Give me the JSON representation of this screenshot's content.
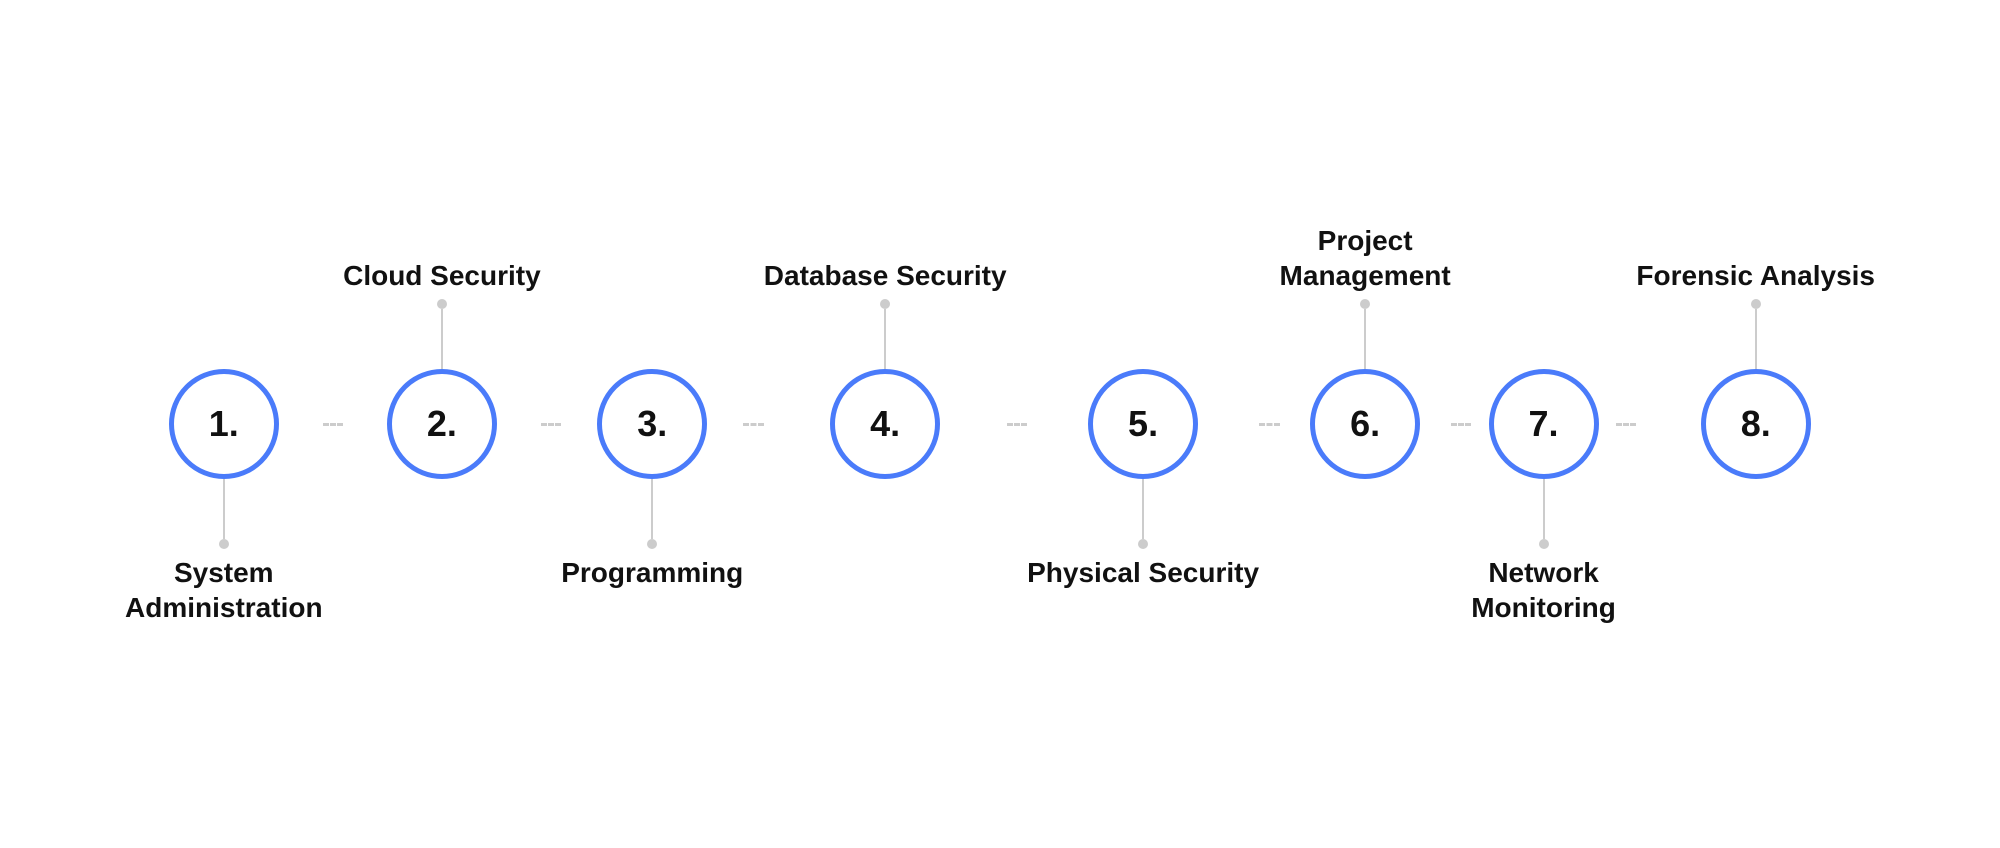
{
  "timeline": {
    "nodes": [
      {
        "number": "1.",
        "top_label": "",
        "bottom_label": "System\nAdministration",
        "has_top": false,
        "has_bottom": true
      },
      {
        "number": "2.",
        "top_label": "Cloud Security",
        "bottom_label": "",
        "has_top": true,
        "has_bottom": false
      },
      {
        "number": "3.",
        "top_label": "",
        "bottom_label": "Programming",
        "has_top": false,
        "has_bottom": true
      },
      {
        "number": "4.",
        "top_label": "Database Security",
        "bottom_label": "",
        "has_top": true,
        "has_bottom": false
      },
      {
        "number": "5.",
        "top_label": "",
        "bottom_label": "Physical Security",
        "has_top": false,
        "has_bottom": true
      },
      {
        "number": "6.",
        "top_label": "Project\nManagement",
        "bottom_label": "",
        "has_top": true,
        "has_bottom": false
      },
      {
        "number": "7.",
        "top_label": "",
        "bottom_label": "Network\nMonitoring",
        "has_top": false,
        "has_bottom": true
      },
      {
        "number": "8.",
        "top_label": "Forensic Analysis",
        "bottom_label": "",
        "has_top": true,
        "has_bottom": false
      }
    ],
    "accent_color": "#4a7bfa",
    "line_color": "#cccccc"
  }
}
